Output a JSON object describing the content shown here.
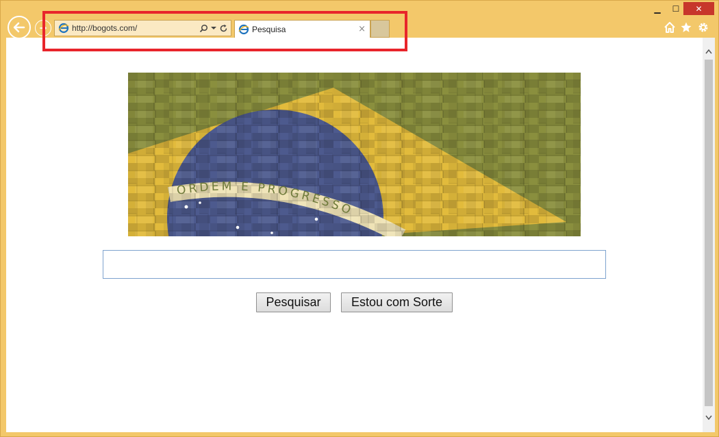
{
  "window": {
    "minimize": "▁",
    "maximize": "☐",
    "close": "✕"
  },
  "address": {
    "url": "http://bogots.com/"
  },
  "tab": {
    "title": "Pesquisa",
    "close": "×"
  },
  "search": {
    "value": "",
    "placeholder": ""
  },
  "buttons": {
    "search_label": "Pesquisar",
    "lucky_label": "Estou com Sorte"
  },
  "banner": {
    "motto": "ORDEM E PROGRESSO"
  },
  "colors": {
    "frame": "#f3c86a",
    "highlight": "#e8252b",
    "flag_green": "#8a8f3e",
    "flag_yellow": "#e2bb3c",
    "flag_blue": "#4d5a8e"
  },
  "icons": [
    "back-arrow-icon",
    "forward-arrow-icon",
    "ie-logo-icon",
    "search-icon",
    "dropdown-icon",
    "refresh-icon",
    "home-icon",
    "star-icon",
    "gear-icon"
  ]
}
